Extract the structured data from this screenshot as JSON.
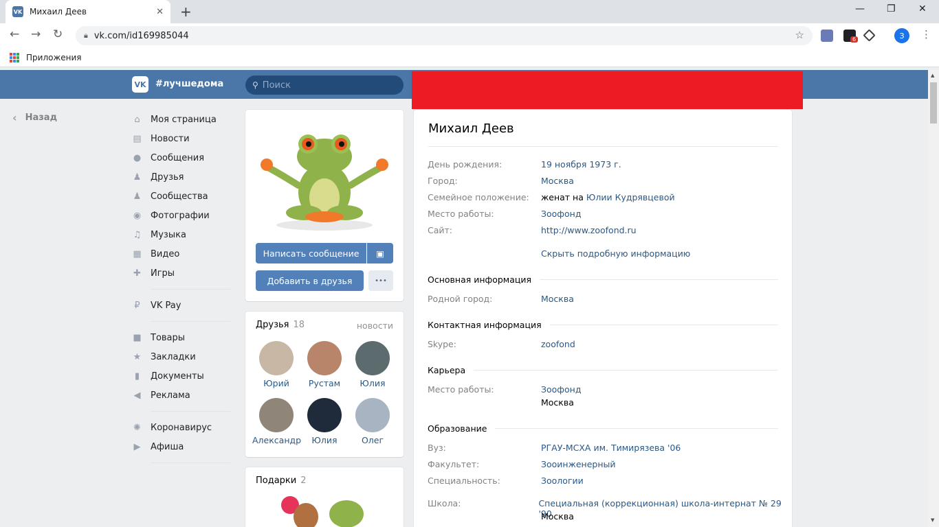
{
  "browser": {
    "tab_title": "Михаил Деев",
    "tab_favicon": "VK",
    "url": "vk.com/id169985044",
    "bookmarks_label": "Приложения",
    "profile_initial": "З",
    "ext_badge": "6"
  },
  "header": {
    "logo": "VK",
    "hashtag": "#лучшедома",
    "search_placeholder": "Поиск",
    "accent": "#4a76a8",
    "redact_color": "#ed1c24"
  },
  "left": {
    "back": "Назад",
    "group1": [
      {
        "label": "Моя страница",
        "icon": "home-icon"
      },
      {
        "label": "Новости",
        "icon": "news-icon"
      },
      {
        "label": "Сообщения",
        "icon": "messages-icon"
      },
      {
        "label": "Друзья",
        "icon": "friends-icon"
      },
      {
        "label": "Сообщества",
        "icon": "communities-icon"
      },
      {
        "label": "Фотографии",
        "icon": "camera-icon"
      },
      {
        "label": "Музыка",
        "icon": "music-icon"
      },
      {
        "label": "Видео",
        "icon": "video-icon"
      },
      {
        "label": "Игры",
        "icon": "games-icon"
      }
    ],
    "group2": [
      {
        "label": "VK Pay",
        "icon": "vkpay-icon"
      }
    ],
    "group3": [
      {
        "label": "Товары",
        "icon": "bag-icon"
      },
      {
        "label": "Закладки",
        "icon": "star-icon"
      },
      {
        "label": "Документы",
        "icon": "document-icon"
      },
      {
        "label": "Реклама",
        "icon": "megaphone-icon"
      }
    ],
    "group4": [
      {
        "label": "Коронавирус",
        "icon": "virus-icon"
      },
      {
        "label": "Афиша",
        "icon": "play-icon"
      }
    ]
  },
  "profile_actions": {
    "message": "Написать сообщение",
    "add_friend": "Добавить в друзья",
    "more": "•••"
  },
  "friends": {
    "title": "Друзья",
    "count": "18",
    "link": "новости",
    "items": [
      {
        "name": "Юрий",
        "color": "#c9b7a5"
      },
      {
        "name": "Рустам",
        "color": "#b9856a"
      },
      {
        "name": "Юлия",
        "color": "#5c6b6e"
      },
      {
        "name": "Александр",
        "color": "#8f8578"
      },
      {
        "name": "Юлия",
        "color": "#1f2a3a"
      },
      {
        "name": "Олег",
        "color": "#a9b4c2"
      }
    ]
  },
  "gifts": {
    "title": "Подарки",
    "count": "2"
  },
  "info": {
    "name": "Михаил Деев",
    "rows": [
      {
        "label": "День рождения:",
        "value": "19 ноября 1973 г."
      },
      {
        "label": "Город:",
        "value": "Москва"
      },
      {
        "label": "Семейное положение:",
        "prefix": "женат на",
        "value": "Юлии Кудрявцевой"
      },
      {
        "label": "Место работы:",
        "value": "Зоофонд"
      },
      {
        "label": "Сайт:",
        "value": "http://www.zoofond.ru"
      }
    ],
    "hide_link": "Скрыть подробную информацию",
    "sections": {
      "basic": {
        "title": "Основная информация",
        "rows": [
          {
            "label": "Родной город:",
            "value": "Москва"
          }
        ]
      },
      "contact": {
        "title": "Контактная информация",
        "rows": [
          {
            "label": "Skype:",
            "value": "zoofond"
          }
        ]
      },
      "career": {
        "title": "Карьера",
        "rows": [
          {
            "label": "Место работы:",
            "value": "Зоофонд",
            "value2": "Москва"
          }
        ]
      },
      "education": {
        "title": "Образование",
        "rows": [
          {
            "label": "Вуз:",
            "value": "РГАУ-МСХА им. Тимирязева '06"
          },
          {
            "label": "Факультет:",
            "value": "Зооинженерный"
          },
          {
            "label": "Специальность:",
            "value": "Зоологии"
          },
          {
            "label": "Школа:",
            "value": "Специальная (коррекционная) школа-интернат № 29 '90",
            "value2": "Москва"
          }
        ]
      }
    }
  }
}
